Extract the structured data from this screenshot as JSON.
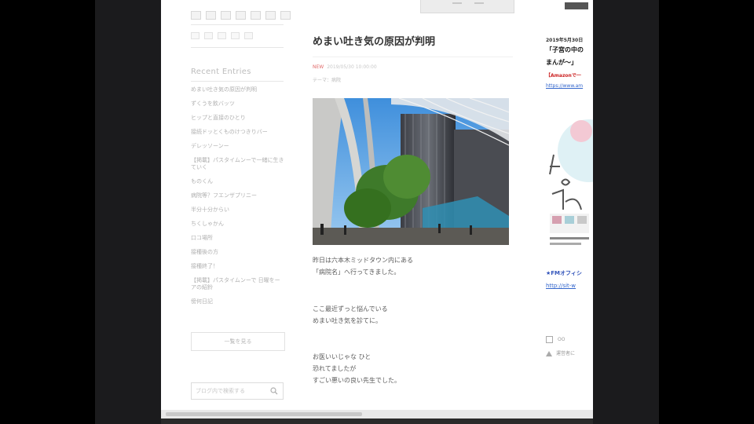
{
  "sidebar": {
    "heading": "Recent Entries",
    "entries": [
      "めまい吐き気の原因が判明",
      "ずくうを飲バッツ",
      "ヒップと直接のひとり",
      "接続ドッとくものけつきりバー",
      "デレッソーンー",
      "【掲載】パスタイムンーで一緒に生きていく",
      "ものくん",
      "病院等？フエンザプリニー",
      "半分十分からい",
      "ちくしゃかん",
      "口コ場所",
      "接種後の方",
      "接種終了！",
      "【掲載】パスタイムンーで 日曜をーアの紹鈴",
      "傍何日記"
    ],
    "list_button": "一覧を見る",
    "search_placeholder": "ブログ内で検索する"
  },
  "post": {
    "title": "めまい吐き気の原因が判明",
    "new_badge": "NEW",
    "date": "2019/05/30 10:00:00",
    "category": "テーマ：病院",
    "paragraphs": [
      [
        "昨日は六本木ミッドタウン内にある",
        "「病院名」へ行ってきました。"
      ],
      [
        "ここ最近ずっと悩んでいる",
        "めまい吐き気を診てに。"
      ],
      [
        "お医いいじゃな  ひと",
        "恐れてましたが",
        "すごい悪いの良い先生でした。"
      ]
    ]
  },
  "right_column": {
    "date": "2019年5月30日",
    "line1": "「子宮の中の",
    "line2": "まんが〜」",
    "amazon": "【Amazonで一",
    "link": "https://www.am",
    "fb": "★FMオフィシ",
    "link2": "http://sit-w",
    "small1": "OO",
    "small2": "運営者に"
  },
  "colors": {
    "accent_red": "#e26b6b",
    "link_blue": "#3366cc",
    "sky": "#6fb2ea"
  }
}
